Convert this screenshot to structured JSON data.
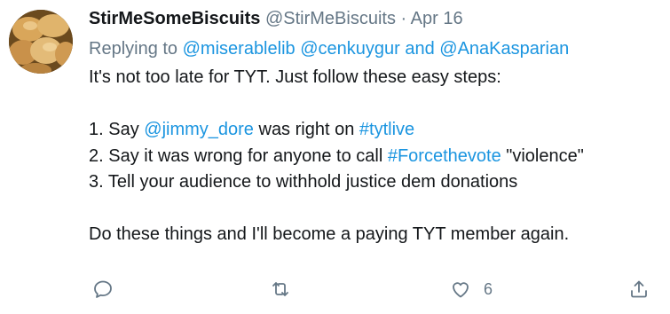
{
  "tweet": {
    "display_name": "StirMeSomeBiscuits",
    "handle": "@StirMeBiscuits",
    "separator": "·",
    "date": "Apr 16",
    "replying_prefix": "Replying to",
    "replying_to": [
      "@miserablelib",
      "@cenkuygur",
      "@AnaKasparian"
    ],
    "replying_and": "and",
    "lines": {
      "l1": "It's not too late for TYT. Just follow these easy steps:",
      "l3a": "1. Say ",
      "l3b": "@jimmy_dore",
      "l3c": " was right on ",
      "l3d": "#tytlive",
      "l4a": "2. Say it was wrong for anyone to call ",
      "l4b": "#Forcethevote",
      "l4c": " \"violence\"",
      "l5": "3. Tell your audience to withhold justice dem donations",
      "l7": "Do these things and I'll become a paying TYT member again."
    },
    "actions": {
      "reply_icon": "reply-icon",
      "retweet_icon": "retweet-icon",
      "like_icon": "heart-icon",
      "like_count": "6",
      "share_icon": "share-icon"
    },
    "colors": {
      "link": "#1b95e0",
      "muted": "#657786",
      "text": "#14171a"
    }
  }
}
